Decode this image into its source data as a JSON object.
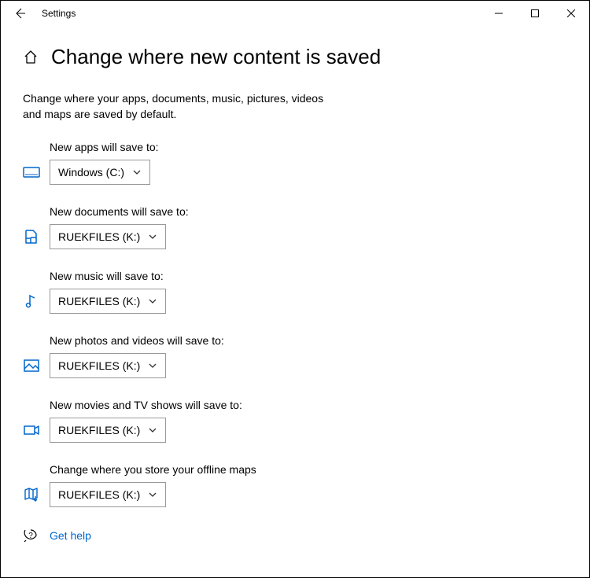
{
  "window": {
    "title": "Settings"
  },
  "page": {
    "heading": "Change where new content is saved",
    "intro": "Change where your apps, documents, music, pictures, videos and maps are saved by default."
  },
  "settings": {
    "apps": {
      "label": "New apps will save to:",
      "value": "Windows (C:)"
    },
    "docs": {
      "label": "New documents will save to:",
      "value": "RUEKFILES (K:)"
    },
    "music": {
      "label": "New music will save to:",
      "value": "RUEKFILES (K:)"
    },
    "photos": {
      "label": "New photos and videos will save to:",
      "value": "RUEKFILES (K:)"
    },
    "movies": {
      "label": "New movies and TV shows will save to:",
      "value": "RUEKFILES (K:)"
    },
    "maps": {
      "label": "Change where you store your offline maps",
      "value": "RUEKFILES (K:)"
    }
  },
  "help": {
    "label": "Get help"
  },
  "colors": {
    "accent": "#0066cc"
  }
}
